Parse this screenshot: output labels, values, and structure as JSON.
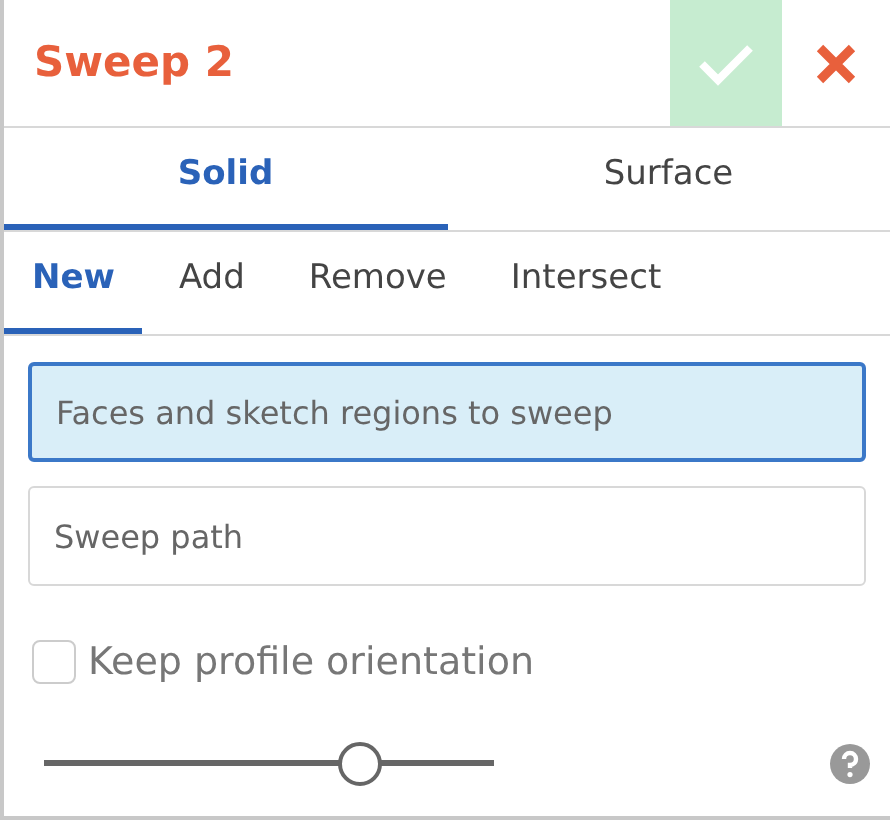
{
  "dialog": {
    "title": "Sweep 2"
  },
  "tabs": [
    {
      "label": "Solid",
      "selected": true
    },
    {
      "label": "Surface",
      "selected": false
    }
  ],
  "operations": [
    {
      "label": "New",
      "selected": true
    },
    {
      "label": "Add",
      "selected": false
    },
    {
      "label": "Remove",
      "selected": false
    },
    {
      "label": "Intersect",
      "selected": false
    }
  ],
  "fields": [
    {
      "placeholder": "Faces and sketch regions to sweep",
      "focused": true
    },
    {
      "placeholder": "Sweep path",
      "focused": false
    }
  ],
  "options": [
    {
      "label": "Keep profile orientation",
      "checked": false
    }
  ],
  "slider": {
    "level": 0.7
  }
}
